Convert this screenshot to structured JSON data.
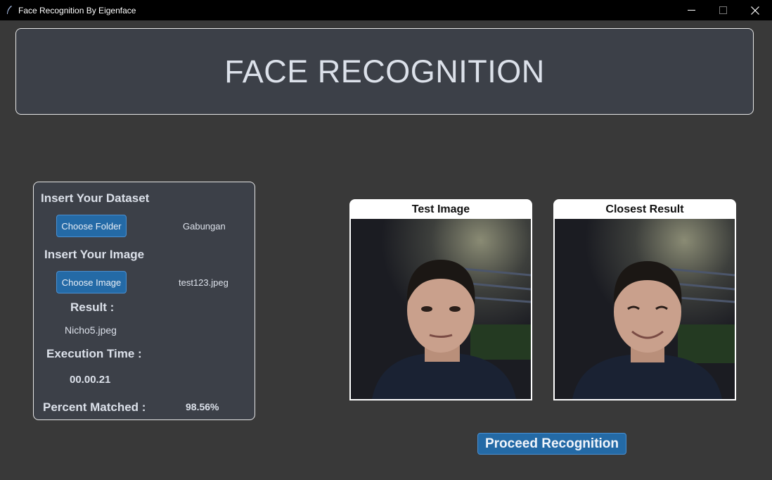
{
  "window": {
    "title": "Face Recognition By Eigenface"
  },
  "header": {
    "title": "FACE RECOGNITION"
  },
  "left_panel": {
    "dataset_label": "Insert Your Dataset",
    "choose_folder_label": "Choose Folder",
    "folder_value": "Gabungan",
    "image_label": "Insert Your Image",
    "choose_image_label": "Choose Image",
    "image_value": "test123.jpeg",
    "result_label": "Result :",
    "result_value": "Nicho5.jpeg",
    "execution_label": "Execution Time :",
    "execution_value": "00.00.21",
    "percent_label": "Percent Matched :",
    "percent_value": "98.56%"
  },
  "images": {
    "test_caption": "Test Image",
    "result_caption": "Closest Result"
  },
  "actions": {
    "proceed_label": "Proceed Recognition"
  },
  "colors": {
    "background": "#393939",
    "panel": "#3c4048",
    "button": "#246aa6",
    "text": "#dce1ea"
  }
}
